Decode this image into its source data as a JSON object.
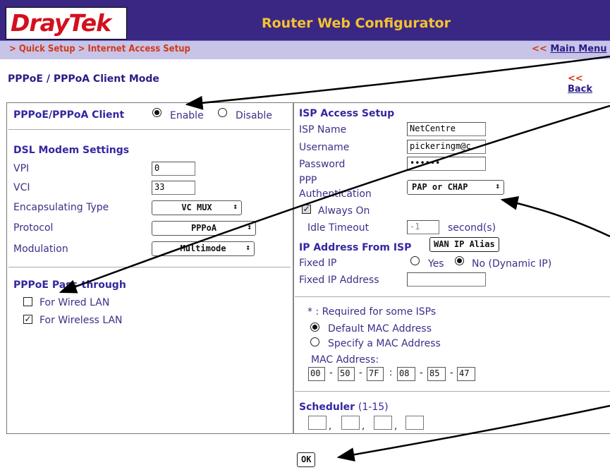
{
  "header": {
    "logo_text": "DrayTek",
    "app_title": "Router Web Configurator",
    "breadcrumb": "> Quick Setup > Internet Access Setup",
    "main_menu_prefix": "<< ",
    "main_menu_link": "Main Menu",
    "mode_title": "PPPoE / PPPoA Client Mode",
    "back_prefix": "<< ",
    "back_link": "Back"
  },
  "left": {
    "client_label": "PPPoE/PPPoA Client",
    "enable_label": "Enable",
    "disable_label": "Disable",
    "client_selected": "Enable",
    "dsl_heading": "DSL Modem Settings",
    "vpi_label": "VPI",
    "vpi_value": "0",
    "vci_label": "VCI",
    "vci_value": "33",
    "encap_label": "Encapsulating Type",
    "encap_value": "VC MUX",
    "protocol_label": "Protocol",
    "protocol_value": "PPPoA",
    "modulation_label": "Modulation",
    "modulation_value": "Multimode",
    "passthrough_heading": "PPPoE Pass-through",
    "wired_label": "For Wired LAN",
    "wired_checked": false,
    "wireless_label": "For Wireless LAN",
    "wireless_checked": true
  },
  "right": {
    "isp_heading": "ISP Access Setup",
    "isp_name_label": "ISP Name",
    "isp_name_value": "NetCentre",
    "username_label": "Username",
    "username_value": "pickeringm@c",
    "password_label": "Password",
    "password_value": "••••••",
    "ppp_auth_label_1": "PPP",
    "ppp_auth_label_2": "Authentication",
    "ppp_auth_value": "PAP or CHAP",
    "always_on_label": "Always On",
    "always_on_checked": true,
    "idle_label": "Idle Timeout",
    "idle_value": "-1",
    "idle_unit": "second(s)",
    "ip_heading": "IP Address From ISP",
    "wan_alias_button": "WAN IP Alias",
    "fixed_ip_label": "Fixed IP",
    "yes_label": "Yes",
    "no_label": "No (Dynamic IP)",
    "fixed_ip_selected": "No",
    "fixed_ip_addr_label": "Fixed IP Address",
    "fixed_ip_addr_value": "",
    "required_note": "* : Required for some ISPs",
    "default_mac_label": "Default MAC Address",
    "specify_mac_label": "Specify a MAC Address",
    "mac_selected": "Default",
    "mac_label": "MAC Address:",
    "mac_octets": [
      "00",
      "50",
      "7F",
      "08",
      "85",
      "47"
    ],
    "scheduler_heading": "Scheduler",
    "scheduler_range": "(1-15)"
  },
  "footer": {
    "ok_button": "OK"
  }
}
